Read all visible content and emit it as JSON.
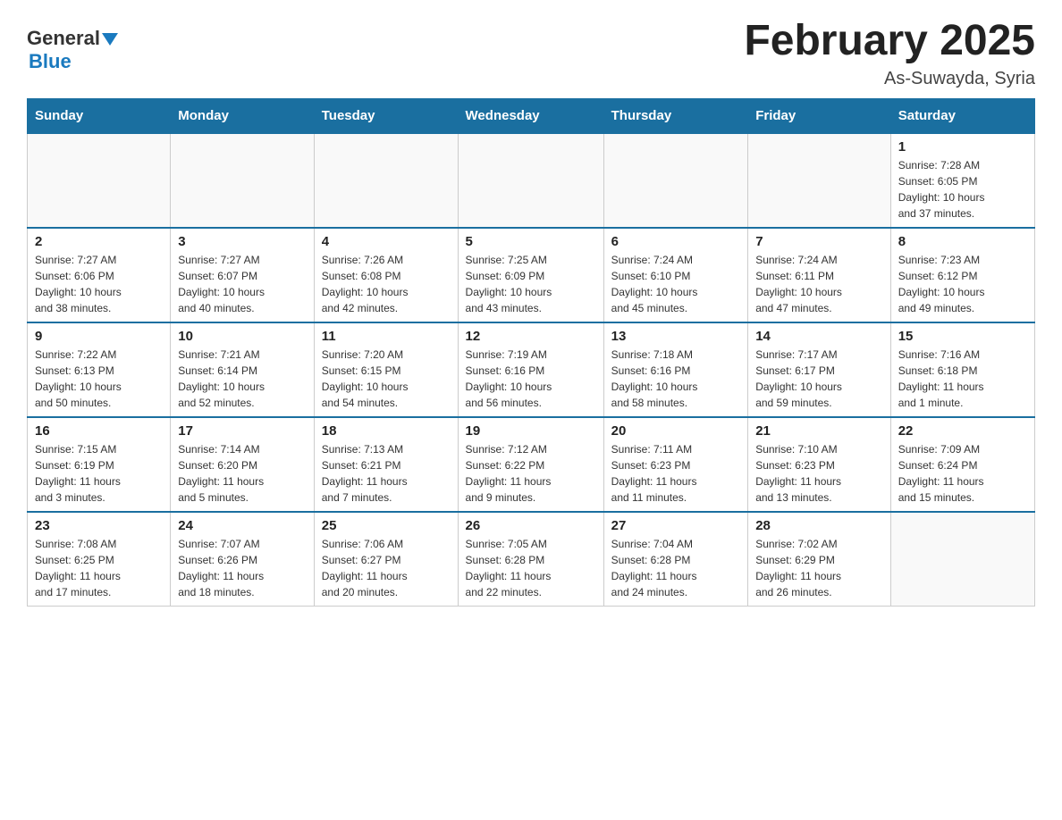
{
  "header": {
    "title": "February 2025",
    "subtitle": "As-Suwayda, Syria"
  },
  "logo": {
    "general": "General",
    "blue": "Blue"
  },
  "days_of_week": [
    "Sunday",
    "Monday",
    "Tuesday",
    "Wednesday",
    "Thursday",
    "Friday",
    "Saturday"
  ],
  "weeks": [
    [
      {
        "day": "",
        "info": ""
      },
      {
        "day": "",
        "info": ""
      },
      {
        "day": "",
        "info": ""
      },
      {
        "day": "",
        "info": ""
      },
      {
        "day": "",
        "info": ""
      },
      {
        "day": "",
        "info": ""
      },
      {
        "day": "1",
        "info": "Sunrise: 7:28 AM\nSunset: 6:05 PM\nDaylight: 10 hours\nand 37 minutes."
      }
    ],
    [
      {
        "day": "2",
        "info": "Sunrise: 7:27 AM\nSunset: 6:06 PM\nDaylight: 10 hours\nand 38 minutes."
      },
      {
        "day": "3",
        "info": "Sunrise: 7:27 AM\nSunset: 6:07 PM\nDaylight: 10 hours\nand 40 minutes."
      },
      {
        "day": "4",
        "info": "Sunrise: 7:26 AM\nSunset: 6:08 PM\nDaylight: 10 hours\nand 42 minutes."
      },
      {
        "day": "5",
        "info": "Sunrise: 7:25 AM\nSunset: 6:09 PM\nDaylight: 10 hours\nand 43 minutes."
      },
      {
        "day": "6",
        "info": "Sunrise: 7:24 AM\nSunset: 6:10 PM\nDaylight: 10 hours\nand 45 minutes."
      },
      {
        "day": "7",
        "info": "Sunrise: 7:24 AM\nSunset: 6:11 PM\nDaylight: 10 hours\nand 47 minutes."
      },
      {
        "day": "8",
        "info": "Sunrise: 7:23 AM\nSunset: 6:12 PM\nDaylight: 10 hours\nand 49 minutes."
      }
    ],
    [
      {
        "day": "9",
        "info": "Sunrise: 7:22 AM\nSunset: 6:13 PM\nDaylight: 10 hours\nand 50 minutes."
      },
      {
        "day": "10",
        "info": "Sunrise: 7:21 AM\nSunset: 6:14 PM\nDaylight: 10 hours\nand 52 minutes."
      },
      {
        "day": "11",
        "info": "Sunrise: 7:20 AM\nSunset: 6:15 PM\nDaylight: 10 hours\nand 54 minutes."
      },
      {
        "day": "12",
        "info": "Sunrise: 7:19 AM\nSunset: 6:16 PM\nDaylight: 10 hours\nand 56 minutes."
      },
      {
        "day": "13",
        "info": "Sunrise: 7:18 AM\nSunset: 6:16 PM\nDaylight: 10 hours\nand 58 minutes."
      },
      {
        "day": "14",
        "info": "Sunrise: 7:17 AM\nSunset: 6:17 PM\nDaylight: 10 hours\nand 59 minutes."
      },
      {
        "day": "15",
        "info": "Sunrise: 7:16 AM\nSunset: 6:18 PM\nDaylight: 11 hours\nand 1 minute."
      }
    ],
    [
      {
        "day": "16",
        "info": "Sunrise: 7:15 AM\nSunset: 6:19 PM\nDaylight: 11 hours\nand 3 minutes."
      },
      {
        "day": "17",
        "info": "Sunrise: 7:14 AM\nSunset: 6:20 PM\nDaylight: 11 hours\nand 5 minutes."
      },
      {
        "day": "18",
        "info": "Sunrise: 7:13 AM\nSunset: 6:21 PM\nDaylight: 11 hours\nand 7 minutes."
      },
      {
        "day": "19",
        "info": "Sunrise: 7:12 AM\nSunset: 6:22 PM\nDaylight: 11 hours\nand 9 minutes."
      },
      {
        "day": "20",
        "info": "Sunrise: 7:11 AM\nSunset: 6:23 PM\nDaylight: 11 hours\nand 11 minutes."
      },
      {
        "day": "21",
        "info": "Sunrise: 7:10 AM\nSunset: 6:23 PM\nDaylight: 11 hours\nand 13 minutes."
      },
      {
        "day": "22",
        "info": "Sunrise: 7:09 AM\nSunset: 6:24 PM\nDaylight: 11 hours\nand 15 minutes."
      }
    ],
    [
      {
        "day": "23",
        "info": "Sunrise: 7:08 AM\nSunset: 6:25 PM\nDaylight: 11 hours\nand 17 minutes."
      },
      {
        "day": "24",
        "info": "Sunrise: 7:07 AM\nSunset: 6:26 PM\nDaylight: 11 hours\nand 18 minutes."
      },
      {
        "day": "25",
        "info": "Sunrise: 7:06 AM\nSunset: 6:27 PM\nDaylight: 11 hours\nand 20 minutes."
      },
      {
        "day": "26",
        "info": "Sunrise: 7:05 AM\nSunset: 6:28 PM\nDaylight: 11 hours\nand 22 minutes."
      },
      {
        "day": "27",
        "info": "Sunrise: 7:04 AM\nSunset: 6:28 PM\nDaylight: 11 hours\nand 24 minutes."
      },
      {
        "day": "28",
        "info": "Sunrise: 7:02 AM\nSunset: 6:29 PM\nDaylight: 11 hours\nand 26 minutes."
      },
      {
        "day": "",
        "info": ""
      }
    ]
  ]
}
